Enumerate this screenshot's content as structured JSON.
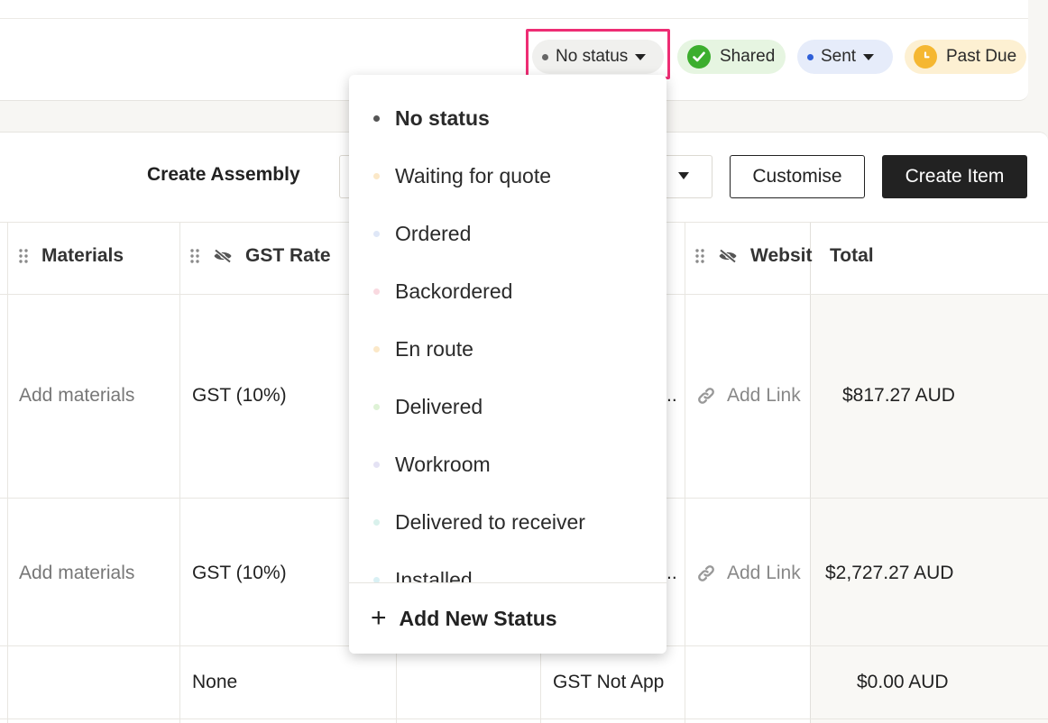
{
  "statusbar": {
    "current_status": "No status",
    "shared": "Shared",
    "sent": "Sent",
    "past_due": "Past Due"
  },
  "toolbar": {
    "create_assembly": "Create Assembly",
    "customise": "Customise",
    "create_item": "Create Item"
  },
  "table": {
    "columns": {
      "materials": "Materials",
      "gst_rate": "GST Rate",
      "website": "Websit",
      "total": "Total"
    },
    "rows": [
      {
        "materials": "Add materials",
        "gst": "GST (10%)",
        "truncated": "..",
        "website": "Add Link",
        "total": "$817.27 AUD"
      },
      {
        "materials": "Add materials",
        "gst": "GST (10%)",
        "truncated": "..",
        "website": "Add Link",
        "total": "$2,727.27 AUD"
      },
      {
        "gst": "None",
        "gst_status": "GST Not App",
        "total": "$0.00 AUD"
      }
    ]
  },
  "status_menu": {
    "items": [
      {
        "label": "No status",
        "color": "#555555"
      },
      {
        "label": "Waiting for quote",
        "color": "#fbe8c8"
      },
      {
        "label": "Ordered",
        "color": "#dfe7f7"
      },
      {
        "label": "Backordered",
        "color": "#f9d9e0"
      },
      {
        "label": "En route",
        "color": "#fbe8c8"
      },
      {
        "label": "Delivered",
        "color": "#def2d6"
      },
      {
        "label": "Workroom",
        "color": "#e4e2f4"
      },
      {
        "label": "Delivered to receiver",
        "color": "#d9f1ec"
      },
      {
        "label": "Installed",
        "color": "#d9f0f4"
      }
    ],
    "add_new": "Add New Status"
  },
  "colors": {
    "highlight": "#ee2d74",
    "shared_check": "#3cae2e",
    "sent_dot": "#2e5fd8",
    "past_due_clock": "#f5b731"
  }
}
